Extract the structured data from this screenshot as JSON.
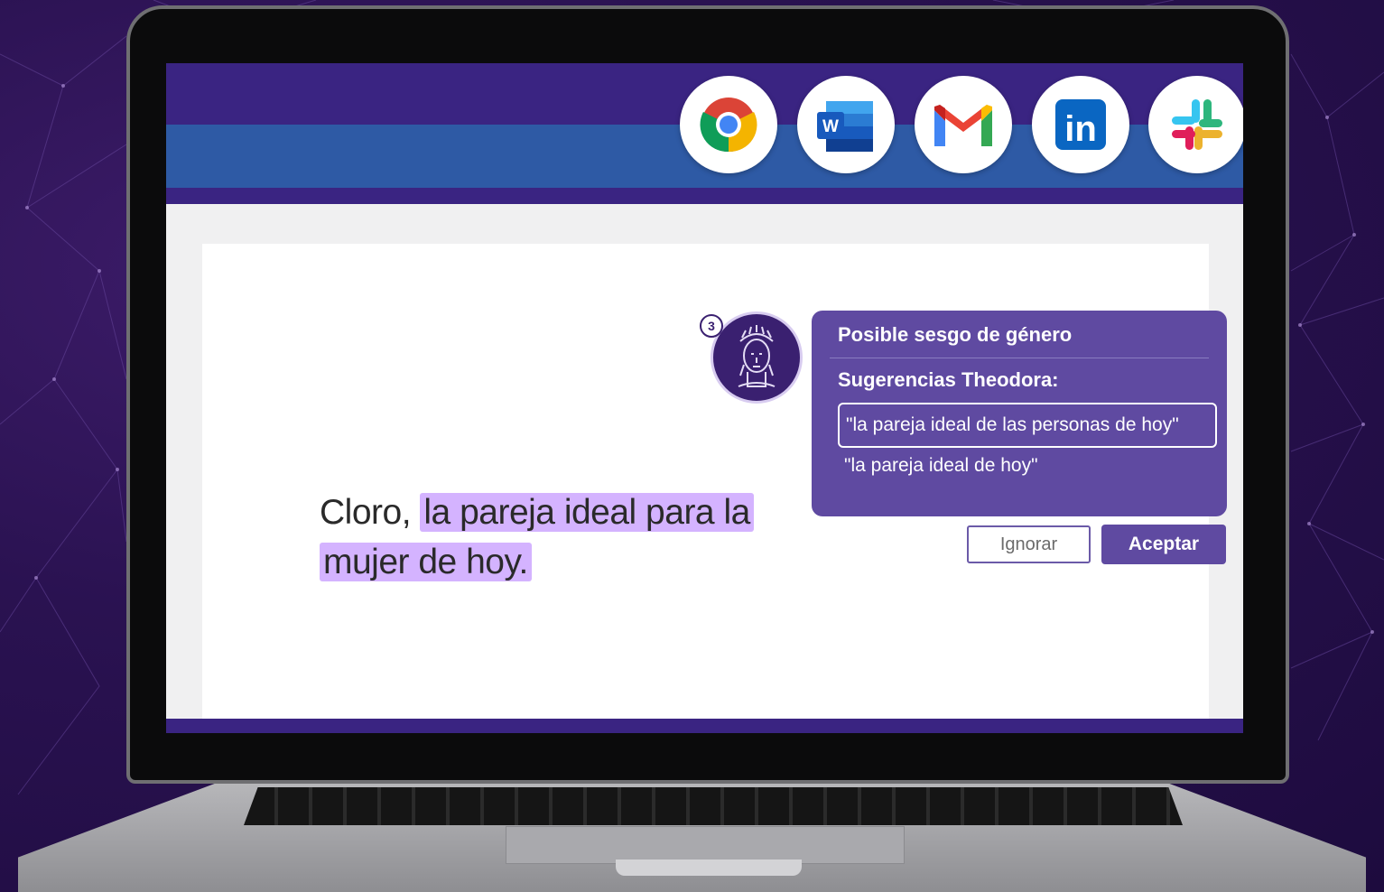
{
  "apps": [
    {
      "name": "chrome",
      "icon": "chrome-icon"
    },
    {
      "name": "word",
      "icon": "word-icon",
      "letter": "W"
    },
    {
      "name": "gmail",
      "icon": "gmail-icon"
    },
    {
      "name": "linkedin",
      "icon": "linkedin-icon",
      "label": "in"
    },
    {
      "name": "slack",
      "icon": "slack-icon"
    }
  ],
  "document": {
    "brand": "Cloro",
    "comma": ",",
    "highlighted_line1": "la pareja ideal para la",
    "highlighted_line2": "mujer de hoy."
  },
  "assistant": {
    "badge": "3",
    "avatar_icon": "theodora-avatar-icon"
  },
  "popup": {
    "title": "Posible sesgo de género",
    "subtitle": "Sugerencias Theodora:",
    "suggestion_1": "\"la pareja ideal de las personas de hoy\"",
    "suggestion_2": "\"la pareja ideal de hoy\"",
    "ignore_label": "Ignorar",
    "accept_label": "Aceptar"
  },
  "colors": {
    "accent": "#5f4aa1",
    "highlight": "#d4b3ff",
    "header_purple": "#3a2482",
    "header_blue": "#2e5aa5"
  }
}
